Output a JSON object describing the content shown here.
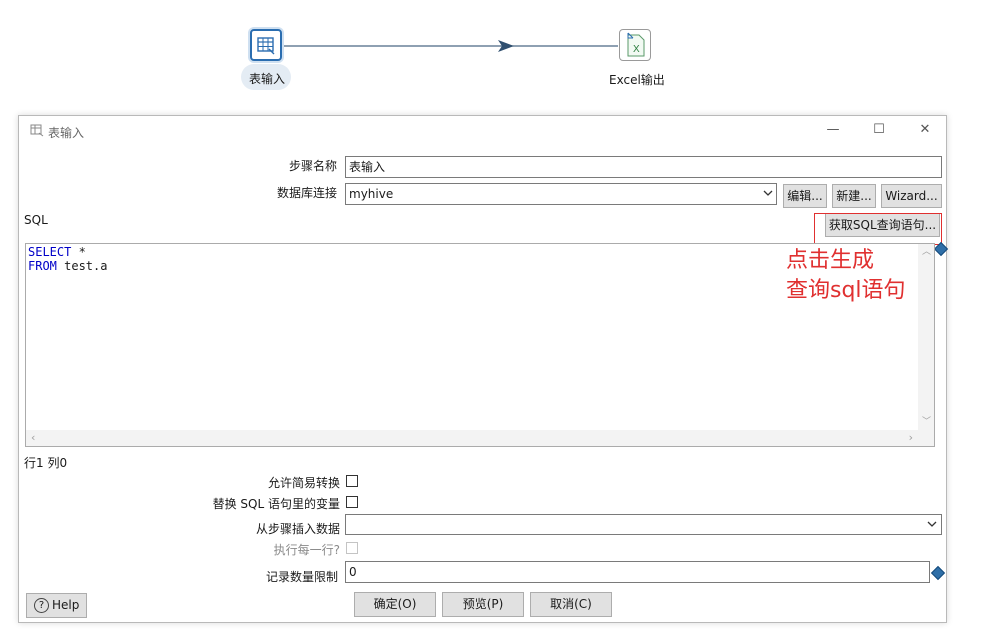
{
  "canvas": {
    "step1_label": "表输入",
    "step2_label": "Excel输出",
    "step2_icon_glyph": "X",
    "accent_color": "#2a6db0"
  },
  "dialog": {
    "title": "表输入",
    "window_buttons": {
      "minimize": "—",
      "maximize": "☐",
      "close": "✕"
    },
    "step_name_label": "步骤名称",
    "step_name_value": "表输入",
    "db_conn_label": "数据库连接",
    "db_conn_value": "myhive",
    "edit_button": "编辑...",
    "new_button": "新建...",
    "wizard_button": "Wizard...",
    "sql_label": "SQL",
    "get_sql_button": "获取SQL查询语句...",
    "sql_lines": [
      {
        "keyword": "SELECT",
        "rest": " *"
      },
      {
        "keyword": "FROM",
        "rest": " test.a"
      }
    ],
    "annotation_line1": "点击生成",
    "annotation_line2": "查询sql语句",
    "cursor_pos": "行1 列0",
    "lazy_conversion_label": "允许简易转换",
    "replace_vars_label": "替换 SQL 语句里的变量",
    "insert_from_step_label": "从步骤插入数据",
    "insert_from_step_value": "",
    "execute_each_row_label": "执行每一行?",
    "limit_label": "记录数量限制",
    "limit_value": "0",
    "help_button": "Help",
    "ok_button": "确定(O)",
    "preview_button": "预览(P)",
    "cancel_button": "取消(C)",
    "annotation_color": "#e03030"
  }
}
